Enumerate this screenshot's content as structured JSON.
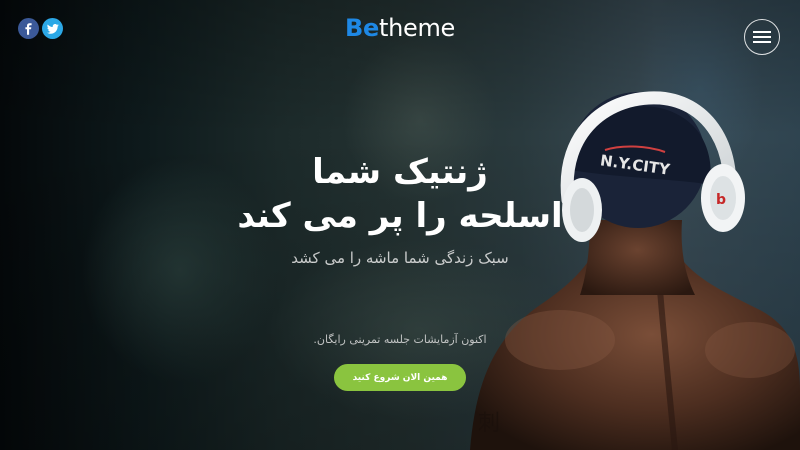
{
  "header": {
    "logo_be": "Be",
    "logo_theme": "theme",
    "social": [
      {
        "name": "facebook",
        "glyph": "f",
        "color": "#3b5998"
      },
      {
        "name": "twitter",
        "glyph": "t",
        "color": "#2ca8e6"
      }
    ],
    "menu_icon": "hamburger-icon"
  },
  "hero": {
    "headline_line1": "ژنتیک شما",
    "headline_line2": "اسلحه را پر می کند",
    "subtitle": "سبک زندگی شما ماشه را می کشد",
    "trial_text": "اکنون آزمایشات جلسه تمرینی رایگان.",
    "cta_label": "همین الان شروع کنید",
    "cap_text": "N.Y.CITY"
  },
  "colors": {
    "brand_blue": "#1e88e5",
    "cta_green": "#8ac43f"
  }
}
